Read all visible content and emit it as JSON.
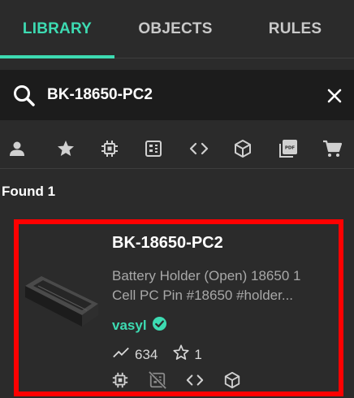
{
  "tabs": [
    {
      "label": "LIBRARY",
      "active": true
    },
    {
      "label": "OBJECTS",
      "active": false
    },
    {
      "label": "RULES",
      "active": false
    }
  ],
  "search": {
    "value": "BK-18650-PC2",
    "icon": "search-icon",
    "clear_icon": "close-icon"
  },
  "filters": [
    {
      "icon": "user-icon"
    },
    {
      "icon": "star-icon"
    },
    {
      "icon": "chip-icon"
    },
    {
      "icon": "footprint-icon"
    },
    {
      "icon": "code-icon"
    },
    {
      "icon": "cube-icon"
    },
    {
      "icon": "pdf-icon"
    },
    {
      "icon": "cart-icon"
    }
  ],
  "results": {
    "found_text": "Found 1"
  },
  "card": {
    "title": "BK-18650-PC2",
    "desc_line1": "Battery Holder (Open) 18650 1",
    "desc_line2": "Cell PC Pin #18650 #holder...",
    "author": "vasyl",
    "views": "634",
    "stars": "1"
  },
  "colors": {
    "accent": "#3ddbb2",
    "background": "#2b2b2b",
    "search_bg": "#1c1c1c",
    "highlight": "#ff0000",
    "muted": "#a8a8a8"
  }
}
